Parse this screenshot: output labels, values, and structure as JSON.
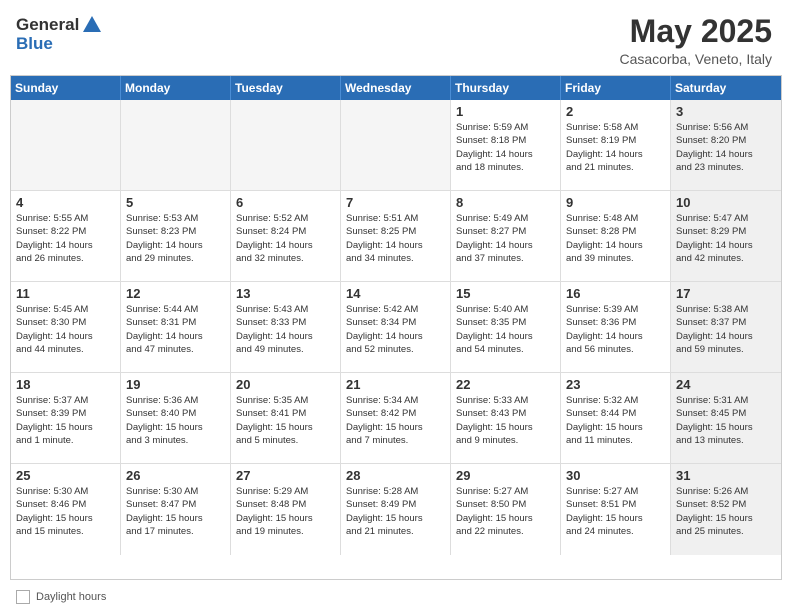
{
  "header": {
    "logo_general": "General",
    "logo_blue": "Blue",
    "month_year": "May 2025",
    "location": "Casacorba, Veneto, Italy"
  },
  "days_of_week": [
    "Sunday",
    "Monday",
    "Tuesday",
    "Wednesday",
    "Thursday",
    "Friday",
    "Saturday"
  ],
  "weeks": [
    [
      {
        "day": "",
        "info": "",
        "empty": true
      },
      {
        "day": "",
        "info": "",
        "empty": true
      },
      {
        "day": "",
        "info": "",
        "empty": true
      },
      {
        "day": "",
        "info": "",
        "empty": true
      },
      {
        "day": "1",
        "info": "Sunrise: 5:59 AM\nSunset: 8:18 PM\nDaylight: 14 hours\nand 18 minutes."
      },
      {
        "day": "2",
        "info": "Sunrise: 5:58 AM\nSunset: 8:19 PM\nDaylight: 14 hours\nand 21 minutes."
      },
      {
        "day": "3",
        "info": "Sunrise: 5:56 AM\nSunset: 8:20 PM\nDaylight: 14 hours\nand 23 minutes.",
        "shaded": true
      }
    ],
    [
      {
        "day": "4",
        "info": "Sunrise: 5:55 AM\nSunset: 8:22 PM\nDaylight: 14 hours\nand 26 minutes."
      },
      {
        "day": "5",
        "info": "Sunrise: 5:53 AM\nSunset: 8:23 PM\nDaylight: 14 hours\nand 29 minutes."
      },
      {
        "day": "6",
        "info": "Sunrise: 5:52 AM\nSunset: 8:24 PM\nDaylight: 14 hours\nand 32 minutes."
      },
      {
        "day": "7",
        "info": "Sunrise: 5:51 AM\nSunset: 8:25 PM\nDaylight: 14 hours\nand 34 minutes."
      },
      {
        "day": "8",
        "info": "Sunrise: 5:49 AM\nSunset: 8:27 PM\nDaylight: 14 hours\nand 37 minutes."
      },
      {
        "day": "9",
        "info": "Sunrise: 5:48 AM\nSunset: 8:28 PM\nDaylight: 14 hours\nand 39 minutes."
      },
      {
        "day": "10",
        "info": "Sunrise: 5:47 AM\nSunset: 8:29 PM\nDaylight: 14 hours\nand 42 minutes.",
        "shaded": true
      }
    ],
    [
      {
        "day": "11",
        "info": "Sunrise: 5:45 AM\nSunset: 8:30 PM\nDaylight: 14 hours\nand 44 minutes."
      },
      {
        "day": "12",
        "info": "Sunrise: 5:44 AM\nSunset: 8:31 PM\nDaylight: 14 hours\nand 47 minutes."
      },
      {
        "day": "13",
        "info": "Sunrise: 5:43 AM\nSunset: 8:33 PM\nDaylight: 14 hours\nand 49 minutes."
      },
      {
        "day": "14",
        "info": "Sunrise: 5:42 AM\nSunset: 8:34 PM\nDaylight: 14 hours\nand 52 minutes."
      },
      {
        "day": "15",
        "info": "Sunrise: 5:40 AM\nSunset: 8:35 PM\nDaylight: 14 hours\nand 54 minutes."
      },
      {
        "day": "16",
        "info": "Sunrise: 5:39 AM\nSunset: 8:36 PM\nDaylight: 14 hours\nand 56 minutes."
      },
      {
        "day": "17",
        "info": "Sunrise: 5:38 AM\nSunset: 8:37 PM\nDaylight: 14 hours\nand 59 minutes.",
        "shaded": true
      }
    ],
    [
      {
        "day": "18",
        "info": "Sunrise: 5:37 AM\nSunset: 8:39 PM\nDaylight: 15 hours\nand 1 minute."
      },
      {
        "day": "19",
        "info": "Sunrise: 5:36 AM\nSunset: 8:40 PM\nDaylight: 15 hours\nand 3 minutes."
      },
      {
        "day": "20",
        "info": "Sunrise: 5:35 AM\nSunset: 8:41 PM\nDaylight: 15 hours\nand 5 minutes."
      },
      {
        "day": "21",
        "info": "Sunrise: 5:34 AM\nSunset: 8:42 PM\nDaylight: 15 hours\nand 7 minutes."
      },
      {
        "day": "22",
        "info": "Sunrise: 5:33 AM\nSunset: 8:43 PM\nDaylight: 15 hours\nand 9 minutes."
      },
      {
        "day": "23",
        "info": "Sunrise: 5:32 AM\nSunset: 8:44 PM\nDaylight: 15 hours\nand 11 minutes."
      },
      {
        "day": "24",
        "info": "Sunrise: 5:31 AM\nSunset: 8:45 PM\nDaylight: 15 hours\nand 13 minutes.",
        "shaded": true
      }
    ],
    [
      {
        "day": "25",
        "info": "Sunrise: 5:30 AM\nSunset: 8:46 PM\nDaylight: 15 hours\nand 15 minutes."
      },
      {
        "day": "26",
        "info": "Sunrise: 5:30 AM\nSunset: 8:47 PM\nDaylight: 15 hours\nand 17 minutes."
      },
      {
        "day": "27",
        "info": "Sunrise: 5:29 AM\nSunset: 8:48 PM\nDaylight: 15 hours\nand 19 minutes."
      },
      {
        "day": "28",
        "info": "Sunrise: 5:28 AM\nSunset: 8:49 PM\nDaylight: 15 hours\nand 21 minutes."
      },
      {
        "day": "29",
        "info": "Sunrise: 5:27 AM\nSunset: 8:50 PM\nDaylight: 15 hours\nand 22 minutes."
      },
      {
        "day": "30",
        "info": "Sunrise: 5:27 AM\nSunset: 8:51 PM\nDaylight: 15 hours\nand 24 minutes."
      },
      {
        "day": "31",
        "info": "Sunrise: 5:26 AM\nSunset: 8:52 PM\nDaylight: 15 hours\nand 25 minutes.",
        "shaded": true
      }
    ]
  ],
  "footer": {
    "legend_label": "Daylight hours"
  }
}
